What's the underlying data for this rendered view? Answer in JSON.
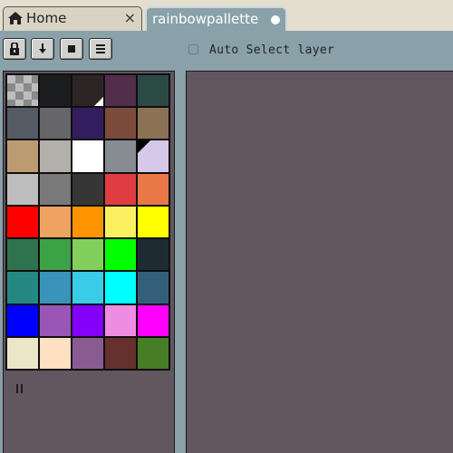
{
  "tabs": [
    {
      "label": "Home",
      "icon": "home-icon",
      "close": "×"
    },
    {
      "label": "rainbowpallette",
      "modified": true
    }
  ],
  "toolbar": {
    "buttons": [
      "lock-icon",
      "download-arrow-icon",
      "square-icon",
      "menu-icon"
    ],
    "auto_select_label": "Auto Select layer",
    "auto_select_checked": false
  },
  "palette": {
    "rows": [
      [
        "transparent",
        "#1b1d1f",
        "#2d2525",
        "#532e4b",
        "#2c4a44"
      ],
      [
        "#555b64",
        "#666668",
        "#341d5e",
        "#7b4b3c",
        "#8b7255"
      ],
      [
        "#bd9c72",
        "#b2b0aa",
        "#ffffff",
        "#868c91",
        "#d5c8ea"
      ],
      [
        "#bdbdbd",
        "#797979",
        "#363636",
        "#df3d41",
        "#e97848"
      ],
      [
        "#ff0000",
        "#eea460",
        "#ff9400",
        "#fbf060",
        "#ffff00"
      ],
      [
        "#2e734e",
        "#3ba246",
        "#83cf5b",
        "#00ff00",
        "#1f2b33"
      ],
      [
        "#258882",
        "#3993bb",
        "#3acce6",
        "#00ffff",
        "#335f7a"
      ],
      [
        "#0000ff",
        "#9a56b6",
        "#8300fa",
        "#ee8ce2",
        "#ff00ff"
      ],
      [
        "#ece6c8",
        "#ffe1c2",
        "#8a5b92",
        "#66302d",
        "#467d25"
      ]
    ],
    "primary": "#2d2525",
    "secondary": "#d5c8ea"
  },
  "colors": {
    "bg": "#62565f",
    "chrome": "#8aa1a9",
    "tabbar": "#e3decf"
  }
}
